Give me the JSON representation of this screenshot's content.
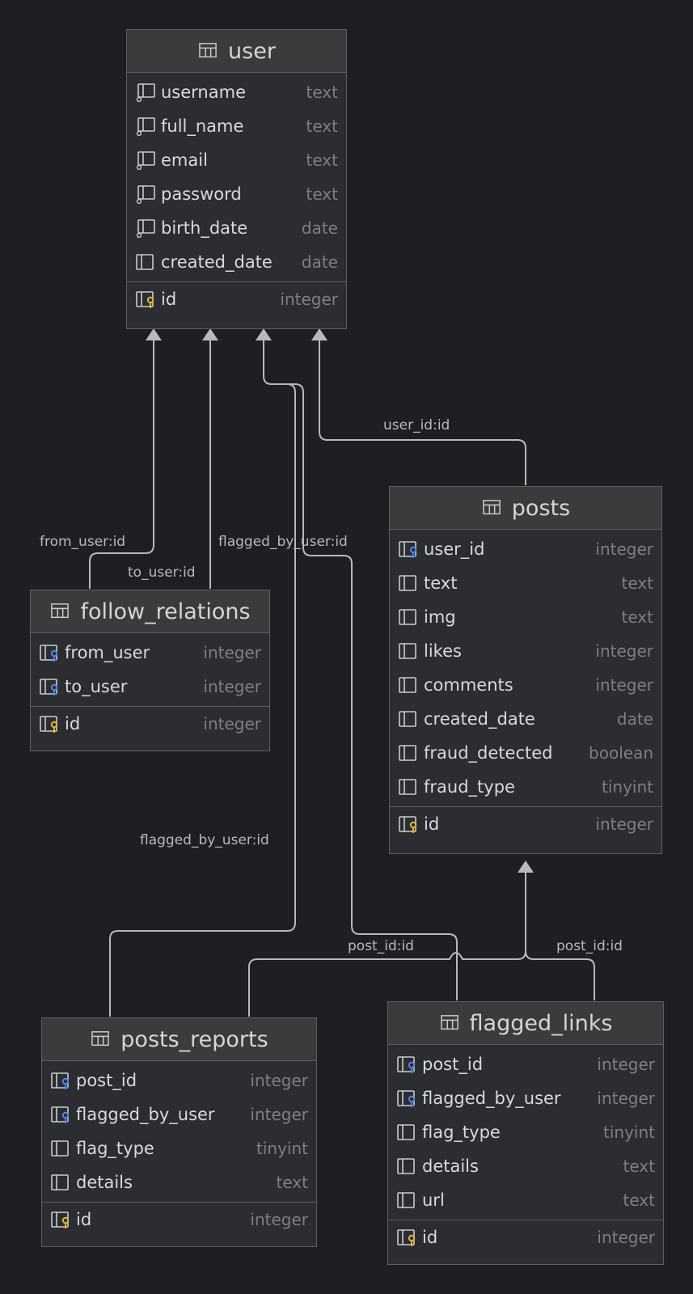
{
  "colors": {
    "background": "#1e1f22",
    "table_bg": "#2b2d30",
    "header_bg": "#3a3b3d",
    "border": "#5b5e63",
    "text": "#d7d9dd",
    "type_text": "#7c7f85",
    "line": "#b8b9bb",
    "pk_key": "#e2b33b",
    "fk_key": "#4f84e6"
  },
  "tables": {
    "user": {
      "name": "user",
      "columns": [
        {
          "name": "username",
          "type": "text",
          "icon": "column-notnull-icon"
        },
        {
          "name": "full_name",
          "type": "text",
          "icon": "column-notnull-icon"
        },
        {
          "name": "email",
          "type": "text",
          "icon": "column-notnull-icon"
        },
        {
          "name": "password",
          "type": "text",
          "icon": "column-notnull-icon"
        },
        {
          "name": "birth_date",
          "type": "date",
          "icon": "column-notnull-icon"
        },
        {
          "name": "created_date",
          "type": "date",
          "icon": "column-icon"
        }
      ],
      "keys": [
        {
          "name": "id",
          "type": "integer",
          "icon": "primary-key-icon"
        }
      ]
    },
    "posts": {
      "name": "posts",
      "columns": [
        {
          "name": "user_id",
          "type": "integer",
          "icon": "foreign-key-icon"
        },
        {
          "name": "text",
          "type": "text",
          "icon": "column-icon"
        },
        {
          "name": "img",
          "type": "text",
          "icon": "column-icon"
        },
        {
          "name": "likes",
          "type": "integer",
          "icon": "column-icon"
        },
        {
          "name": "comments",
          "type": "integer",
          "icon": "column-icon"
        },
        {
          "name": "created_date",
          "type": "date",
          "icon": "column-icon"
        },
        {
          "name": "fraud_detected",
          "type": "boolean",
          "icon": "column-icon"
        },
        {
          "name": "fraud_type",
          "type": "tinyint",
          "icon": "column-icon"
        }
      ],
      "keys": [
        {
          "name": "id",
          "type": "integer",
          "icon": "primary-key-icon"
        }
      ]
    },
    "follow_relations": {
      "name": "follow_relations",
      "columns": [
        {
          "name": "from_user",
          "type": "integer",
          "icon": "foreign-key-icon"
        },
        {
          "name": "to_user",
          "type": "integer",
          "icon": "foreign-key-icon"
        }
      ],
      "keys": [
        {
          "name": "id",
          "type": "integer",
          "icon": "primary-key-icon"
        }
      ]
    },
    "posts_reports": {
      "name": "posts_reports",
      "columns": [
        {
          "name": "post_id",
          "type": "integer",
          "icon": "foreign-key-icon"
        },
        {
          "name": "flagged_by_user",
          "type": "integer",
          "icon": "foreign-key-icon"
        },
        {
          "name": "flag_type",
          "type": "tinyint",
          "icon": "column-icon"
        },
        {
          "name": "details",
          "type": "text",
          "icon": "column-icon"
        }
      ],
      "keys": [
        {
          "name": "id",
          "type": "integer",
          "icon": "primary-key-icon"
        }
      ]
    },
    "flagged_links": {
      "name": "flagged_links",
      "columns": [
        {
          "name": "post_id",
          "type": "integer",
          "icon": "foreign-key-icon"
        },
        {
          "name": "flagged_by_user",
          "type": "integer",
          "icon": "foreign-key-icon"
        },
        {
          "name": "flag_type",
          "type": "tinyint",
          "icon": "column-icon"
        },
        {
          "name": "details",
          "type": "text",
          "icon": "column-icon"
        },
        {
          "name": "url",
          "type": "text",
          "icon": "column-icon"
        }
      ],
      "keys": [
        {
          "name": "id",
          "type": "integer",
          "icon": "primary-key-icon"
        }
      ]
    }
  },
  "relations": {
    "posts_user": "user_id:id",
    "follow_from": "from_user:id",
    "follow_to": "to_user:id",
    "links_user": "flagged_by_user:id",
    "reports_user": "flagged_by_user:id",
    "reports_post": "post_id:id",
    "links_post": "post_id:id"
  }
}
